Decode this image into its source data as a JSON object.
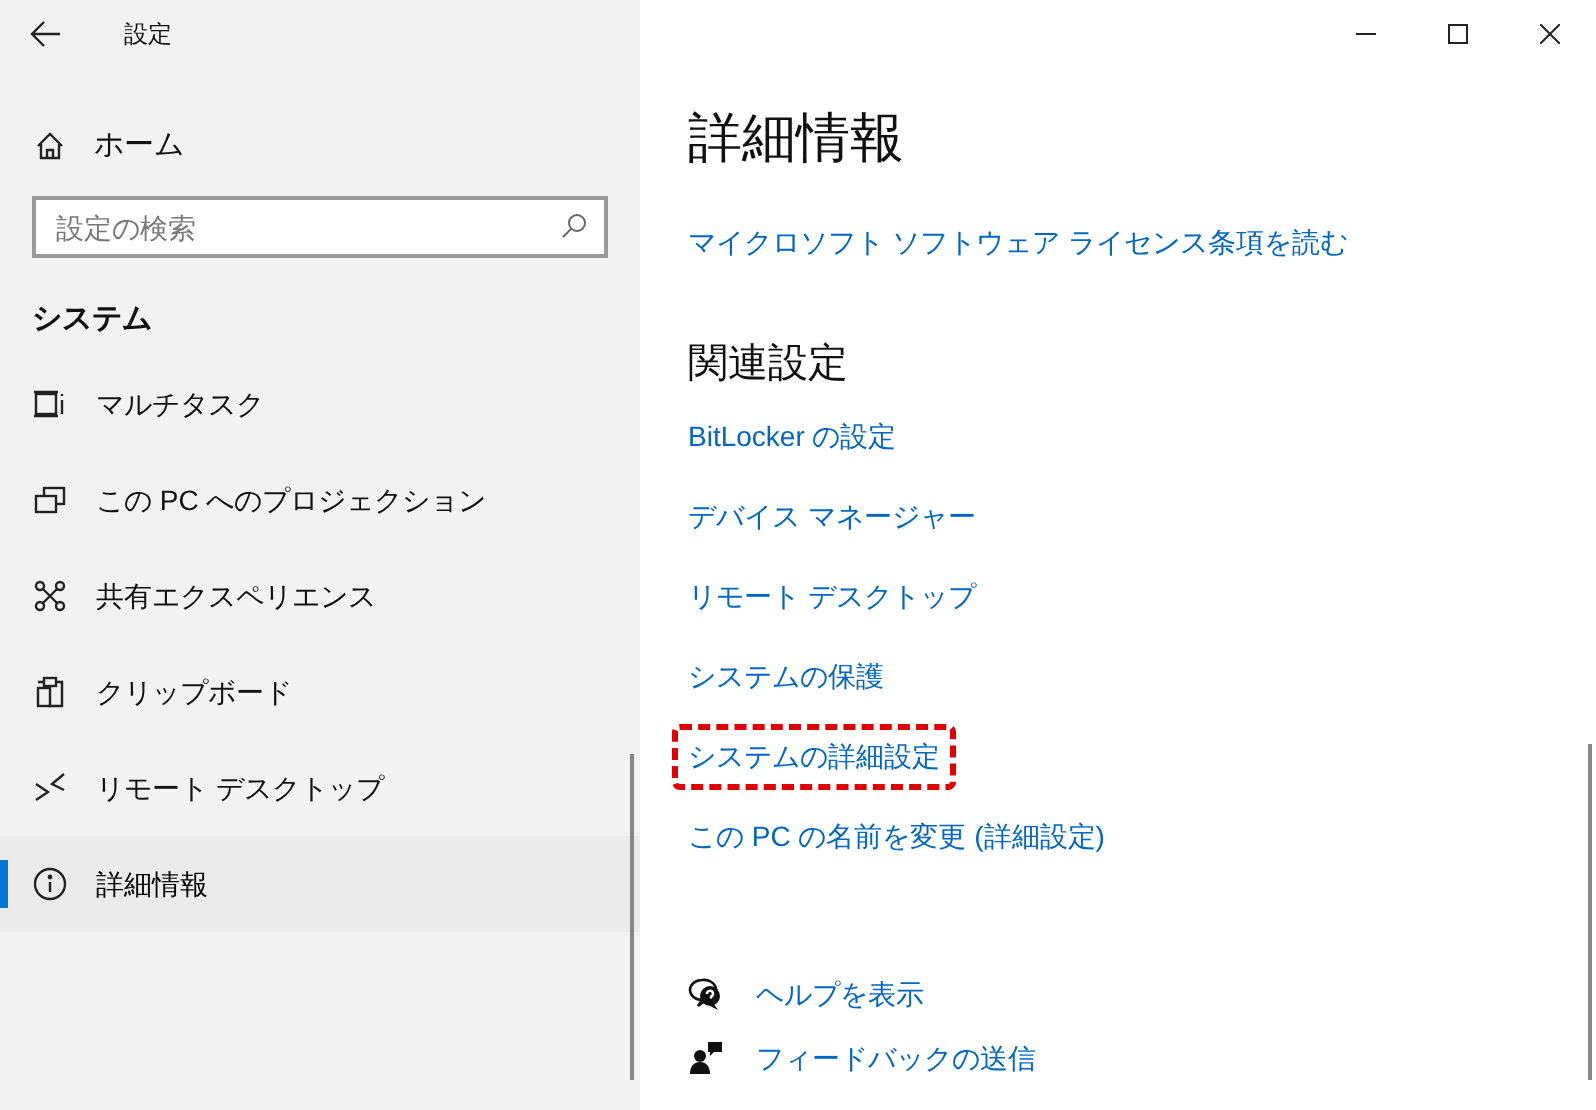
{
  "window": {
    "title": "設定"
  },
  "sidebar": {
    "home": "ホーム",
    "search": {
      "placeholder": "設定の検索"
    },
    "section": "システム",
    "items": [
      {
        "label": "マルチタスク",
        "kind": "multitask",
        "selected": false
      },
      {
        "label": "この PC へのプロジェクション",
        "kind": "project",
        "selected": false
      },
      {
        "label": "共有エクスペリエンス",
        "kind": "share",
        "selected": false
      },
      {
        "label": "クリップボード",
        "kind": "clipboard",
        "selected": false
      },
      {
        "label": "リモート デスクトップ",
        "kind": "remote",
        "selected": false
      },
      {
        "label": "詳細情報",
        "kind": "info",
        "selected": true
      }
    ]
  },
  "content": {
    "title": "詳細情報",
    "license_link": "マイクロソフト ソフトウェア ライセンス条項を読む",
    "related_heading": "関連設定",
    "related_links": [
      {
        "label": "BitLocker の設定",
        "highlighted": false
      },
      {
        "label": "デバイス マネージャー",
        "highlighted": false
      },
      {
        "label": "リモート デスクトップ",
        "highlighted": false
      },
      {
        "label": "システムの保護",
        "highlighted": false
      },
      {
        "label": "システムの詳細設定",
        "highlighted": true
      },
      {
        "label": "この PC の名前を変更 (詳細設定)",
        "highlighted": false
      }
    ],
    "help_links": [
      {
        "label": "ヘルプを表示",
        "kind": "help"
      },
      {
        "label": "フィードバックの送信",
        "kind": "feedback"
      }
    ]
  }
}
